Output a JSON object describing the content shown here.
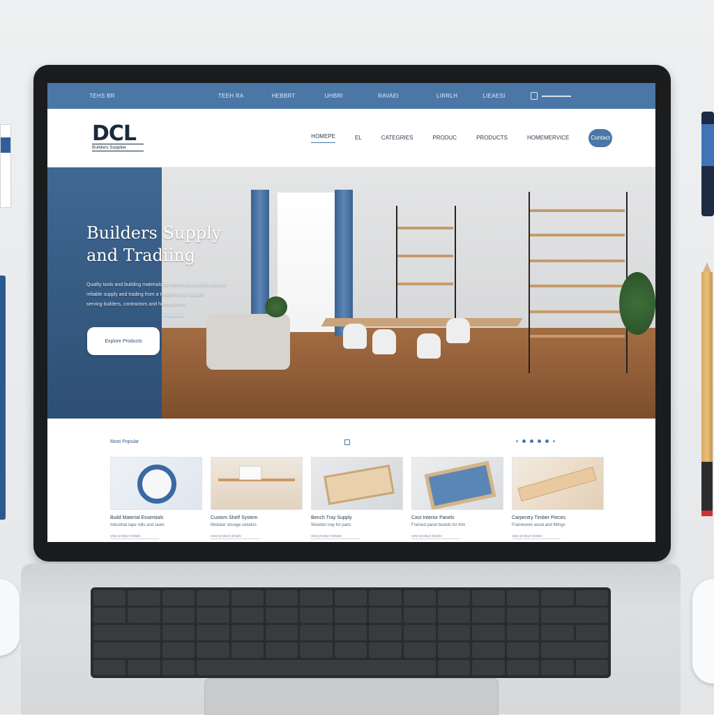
{
  "colors": {
    "accent": "#4a77a6",
    "hero_panel": "#3f6893",
    "topbar": "#4a77a6"
  },
  "topbar": {
    "items": [
      "TEHS BR",
      "TEEH RA",
      "HEBBRT",
      "UHBRI",
      "RAVAEI",
      "LIRRLH",
      "LIEAESI"
    ],
    "icon": "lock-icon"
  },
  "header": {
    "logo_main": "DCL",
    "logo_sub": "Builders Supplier",
    "menu": [
      "HOMEPE",
      "EL",
      "CATEGRIES",
      "PRODUC",
      "PRODUCTS",
      "HOMEMERVICE"
    ],
    "cta": "Contact"
  },
  "hero": {
    "title_line1": "Builders Supply",
    "title_line2": "and Tradiing",
    "body_line1": "Quality tools and building materials for every construction project",
    "body_line2": "reliable supply and trading from a trusted local supplier",
    "body_line3": "serving builders, contractors and homeowners",
    "link": "Learn more",
    "button": "Explore Products"
  },
  "featured": {
    "title": "Most Popular",
    "cards": [
      {
        "title": "Build Material Essentials",
        "sub": "Industrial tape rolls and seals",
        "note": "view product details",
        "icon": "tape-roll-icon"
      },
      {
        "title": "Custom Shelf System",
        "sub": "Modular storage solution",
        "note": "view product details",
        "icon": "shelf-icon"
      },
      {
        "title": "Bench Tray Supply",
        "sub": "Wooden tray for parts",
        "note": "view product details",
        "icon": "tray-icon"
      },
      {
        "title": "Cast Interior Panels",
        "sub": "Framed panel boards for trim",
        "note": "view product details",
        "icon": "panel-icon"
      },
      {
        "title": "Carpentry Timber Pieces",
        "sub": "Framework wood and fittings",
        "note": "view product details",
        "icon": "timber-icon"
      }
    ]
  }
}
